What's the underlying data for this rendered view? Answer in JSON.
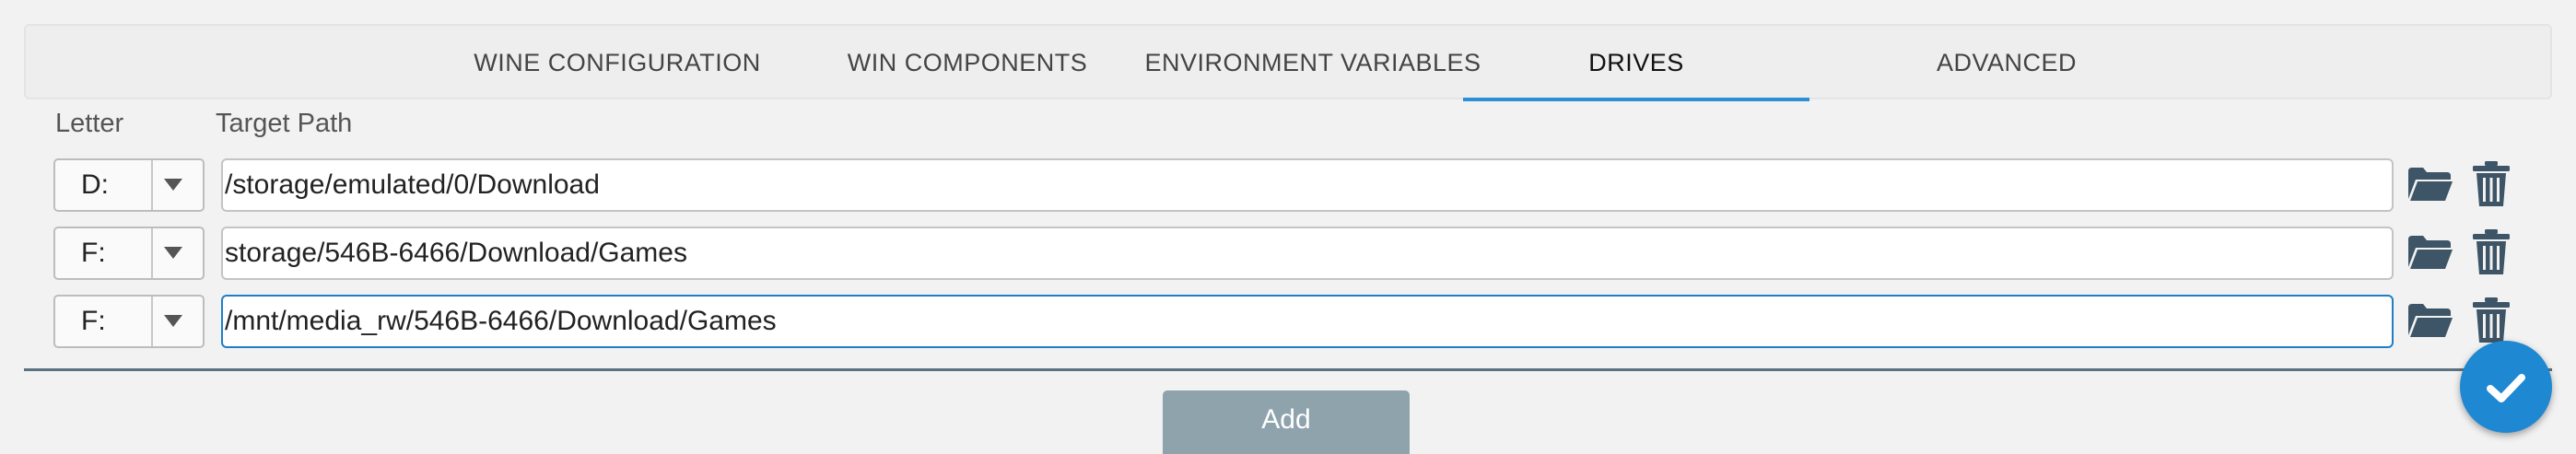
{
  "tabs": [
    {
      "label": "WINE CONFIGURATION",
      "active": false
    },
    {
      "label": "WIN COMPONENTS",
      "active": false
    },
    {
      "label": "ENVIRONMENT VARIABLES",
      "active": false
    },
    {
      "label": "DRIVES",
      "active": true
    },
    {
      "label": "ADVANCED",
      "active": false
    }
  ],
  "columns": {
    "letter": "Letter",
    "target_path": "Target Path"
  },
  "drives": [
    {
      "letter": "D:",
      "path": "/storage/emulated/0/Download"
    },
    {
      "letter": "F:",
      "path": "storage/546B-6466/Download/Games"
    },
    {
      "letter": "F:",
      "path": "/mnt/media_rw/546B-6466/Download/Games",
      "focused": true
    }
  ],
  "add_button": {
    "label": "Add"
  },
  "icons": {
    "folder": "folder-icon",
    "trash": "trash-icon",
    "confirm": "checkmark-icon",
    "dropdown": "chevron-down-icon"
  },
  "colors": {
    "accent": "#2a8fd6",
    "fab": "#1e88d2",
    "add_button": "#8fa3ad",
    "icon": "#3d5566"
  }
}
